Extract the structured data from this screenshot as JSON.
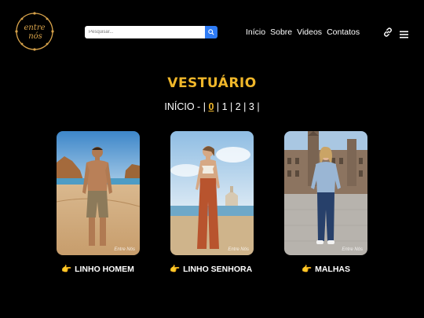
{
  "brand": {
    "logo_text_line1": "entre",
    "logo_text_line2": "nós"
  },
  "search": {
    "placeholder": "Pesquisar..."
  },
  "nav": {
    "items": [
      "Início",
      "Sobre",
      "Videos",
      "Contatos"
    ]
  },
  "page": {
    "title": "VESTUÁRIO"
  },
  "pager": {
    "prefix": "INÍCIO - |",
    "current": "0",
    "pages": [
      "1",
      "2",
      "3"
    ]
  },
  "cards": [
    {
      "label": "LINHO HOMEM",
      "watermark": "Entre Nós"
    },
    {
      "label": "LINHO SENHORA",
      "watermark": "Entre Nós"
    },
    {
      "label": "MALHAS",
      "watermark": "Entre Nós"
    }
  ],
  "icons": {
    "pointer": "👉"
  },
  "colors": {
    "accent": "#f0b72a",
    "search_button": "#2f7cf6",
    "background": "#000000"
  }
}
